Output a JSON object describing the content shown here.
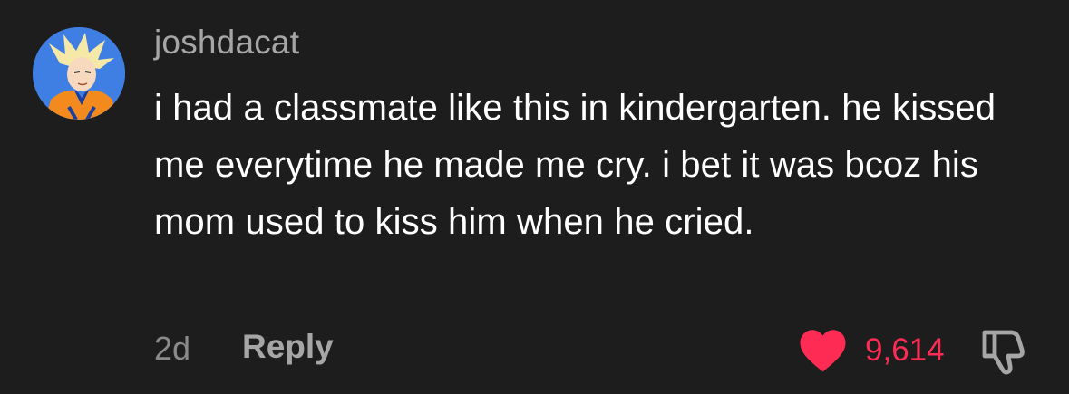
{
  "comment": {
    "avatar_icon": "user-avatar",
    "username": "joshdacat",
    "text": "i had a classmate like this in kindergarten. he kissed me everytime he made me cry. i bet it was bcoz his mom used to kiss him when he cried.",
    "time_ago": "2d",
    "reply_label": "Reply",
    "like_count": "9,614",
    "liked": true,
    "icons": {
      "like": "heart-icon",
      "dislike": "thumbs-down-icon"
    },
    "colors": {
      "background": "#1d1d1d",
      "like_accent": "#fe2c55",
      "username": "#a6a6a6",
      "text": "#ffffff"
    }
  }
}
